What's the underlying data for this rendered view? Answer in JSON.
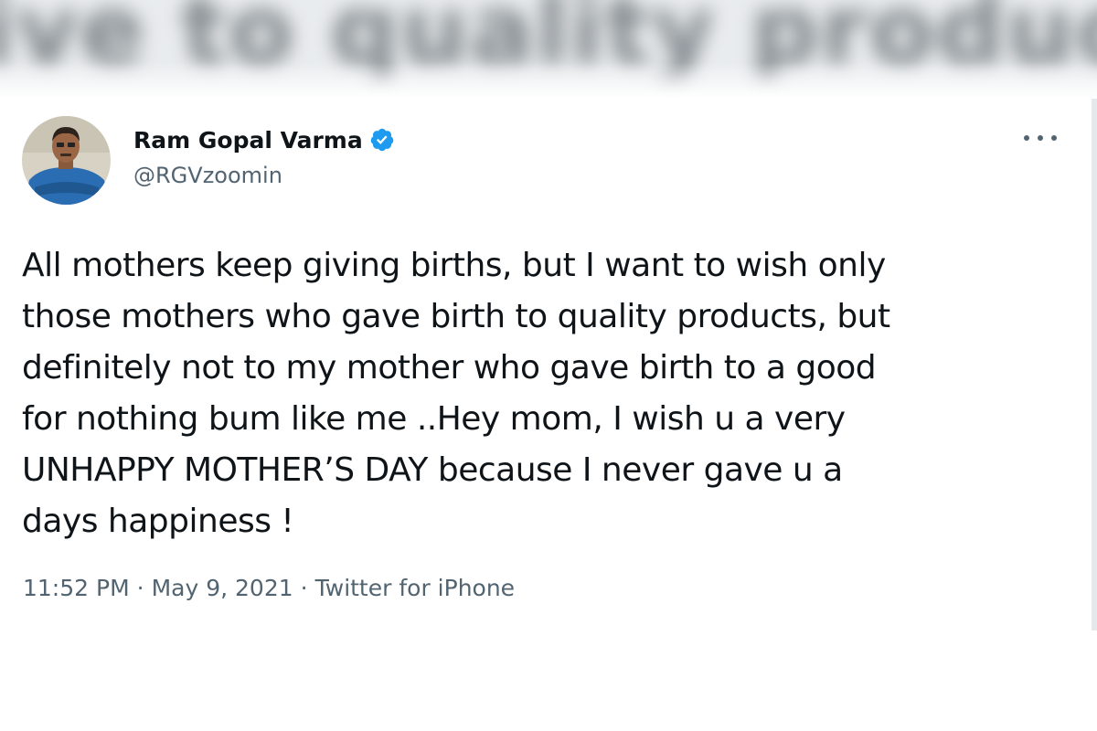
{
  "banner": {
    "blurred_text": "ive to quality products"
  },
  "tweet": {
    "author": {
      "display_name": "Ram Gopal Varma",
      "handle": "@RGVzoomin",
      "verified": true
    },
    "text": "All mothers keep giving births, but I want to wish only\nthose mothers who gave birth to quality products, but\ndefinitely not to my mother who gave birth to a good\nfor nothing bum like me ..Hey mom, I wish u a very\nUNHAPPY MOTHER’S DAY because I never gave u a\ndays happiness !",
    "time": "11:52 PM",
    "separator": "·",
    "date": "May 9, 2021",
    "source": "Twitter for iPhone"
  },
  "icons": {
    "verified": "verified-badge-icon",
    "more": "more-options-icon"
  },
  "colors": {
    "verified_blue": "#1d9bf0",
    "text_primary": "#0f1419",
    "text_secondary": "#536471"
  }
}
